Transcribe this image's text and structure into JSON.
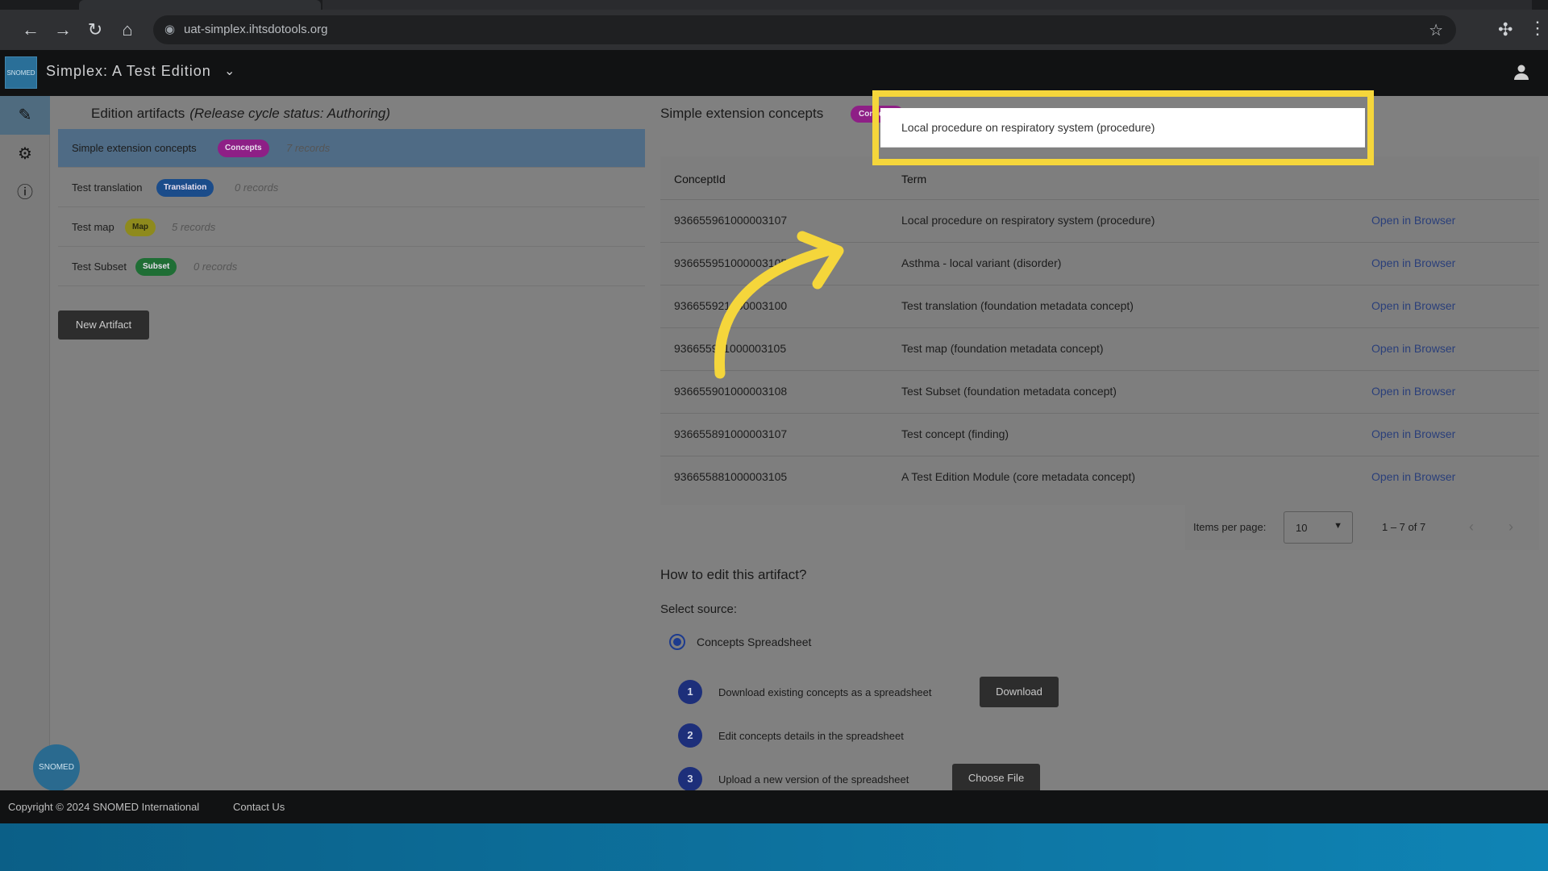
{
  "browser": {
    "url": "uat-simplex.ihtsdotools.org"
  },
  "header": {
    "logo_text": "SNOMED",
    "title": "Simplex: A Test Edition"
  },
  "left_panel": {
    "title": "Edition artifacts",
    "status": "(Release cycle status: Authoring)",
    "artifacts": [
      {
        "name": "Simple extension concepts",
        "badge": "Concepts",
        "records": "7 records"
      },
      {
        "name": "Test translation",
        "badge": "Translation",
        "records": "0 records"
      },
      {
        "name": "Test map",
        "badge": "Map",
        "records": "5 records"
      },
      {
        "name": "Test Subset",
        "badge": "Subset",
        "records": "0 records"
      }
    ],
    "new_button": "New Artifact"
  },
  "right_panel": {
    "title": "Simple extension concepts",
    "badge": "Concepts",
    "columns": [
      "ConceptId",
      "Term"
    ],
    "rows": [
      {
        "id": "936655961000003107",
        "term": "Local procedure on respiratory system (procedure)",
        "action": "Open in Browser"
      },
      {
        "id": "936655951000003105",
        "term": "Asthma - local variant (disorder)",
        "action": "Open in Browser"
      },
      {
        "id": "936655921000003100",
        "term": "Test translation (foundation metadata concept)",
        "action": "Open in Browser"
      },
      {
        "id": "936655911000003105",
        "term": "Test map (foundation metadata concept)",
        "action": "Open in Browser"
      },
      {
        "id": "936655901000003108",
        "term": "Test Subset (foundation metadata concept)",
        "action": "Open in Browser"
      },
      {
        "id": "936655891000003107",
        "term": "Test concept (finding)",
        "action": "Open in Browser"
      },
      {
        "id": "936655881000003105",
        "term": "A Test Edition Module (core metadata concept)",
        "action": "Open in Browser"
      }
    ],
    "pager": {
      "label": "Items per page:",
      "value": "10",
      "range": "1 – 7 of 7"
    },
    "how_title": "How to edit this artifact?",
    "select_source": "Select source:",
    "source_option": "Concepts Spreadsheet",
    "steps": [
      {
        "num": "1",
        "text": "Download existing concepts as a spreadsheet"
      },
      {
        "num": "2",
        "text": "Edit concepts details in the spreadsheet"
      },
      {
        "num": "3",
        "text": "Upload a new version of the spreadsheet"
      }
    ],
    "download_button": "Download",
    "choose_file_button": "Choose File"
  },
  "footer": {
    "copyright": "Copyright © 2024 SNOMED International",
    "contact": "Contact Us"
  },
  "colors": {
    "highlight": "#f5d63b",
    "concepts_badge": "#8e1f86",
    "step_circle": "#1d2f7a"
  }
}
